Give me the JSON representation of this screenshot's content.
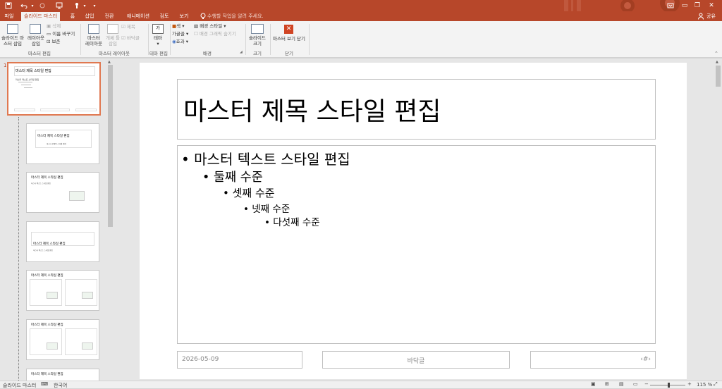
{
  "app": {
    "accent": "#b7472a"
  },
  "qat": {
    "save_icon": "save-icon",
    "undo_icon": "undo-icon",
    "redo_icon": "redo-icon",
    "start_icon": "slideshow-start-icon",
    "touch_icon": "touch-mode-icon",
    "more_icon": "customize-qat-icon"
  },
  "window": {
    "minimize": "▭",
    "restore": "❐",
    "close": "✕"
  },
  "tabs": [
    "파일",
    "슬라이드 마스터",
    "홈",
    "삽입",
    "전환",
    "애니메이션",
    "검토",
    "보기"
  ],
  "tell_me": "수행할 작업을 알려 주세요.",
  "share": "공유",
  "ribbon": {
    "edit_master": {
      "insert_master": "슬라이드 마\n스터 삽입",
      "insert_layout": "레이아웃\n삽입",
      "delete": "삭제",
      "rename": "이름 바꾸기",
      "preserve": "보존",
      "label": "마스터 편집"
    },
    "master_layout": {
      "master_layout_btn": "마스터\n레이아웃",
      "insert_placeholder": "개체 틀\n삽입",
      "title_cb": "제목",
      "footer_cb": "바닥글",
      "label": "마스터 레이아웃"
    },
    "edit_theme": {
      "themes": "테마",
      "label": "테마 편집"
    },
    "background": {
      "colors": "색",
      "fonts": "글꼴",
      "effects": "효과",
      "bg_styles": "배경 스타일",
      "hide_bg": "배경 그래픽 숨기기",
      "label": "배경"
    },
    "size": {
      "slide_size": "슬라이드\n크기",
      "label": "크기"
    },
    "close": {
      "close_master": "마스터 보기 닫기",
      "label": "닫기"
    }
  },
  "thumbnails": {
    "number": "1",
    "master_title": "마스터 제목 스타일 편집",
    "master_body": "마스터 텍스트 스타일 편집",
    "sub_title": "마스터 부제목 스타일 편집"
  },
  "slide": {
    "title": "마스터 제목 스타일 편집",
    "levels": [
      "마스터 텍스트 스타일 편집",
      "둘째 수준",
      "셋째 수준",
      "넷째 수준",
      "다섯째 수준"
    ],
    "date": "2026-05-09",
    "footer": "바닥글",
    "number": "‹#›"
  },
  "status": {
    "view": "슬라이드 마스터",
    "language": "한국어",
    "zoom": "115 %",
    "zoom_pct": 115
  }
}
